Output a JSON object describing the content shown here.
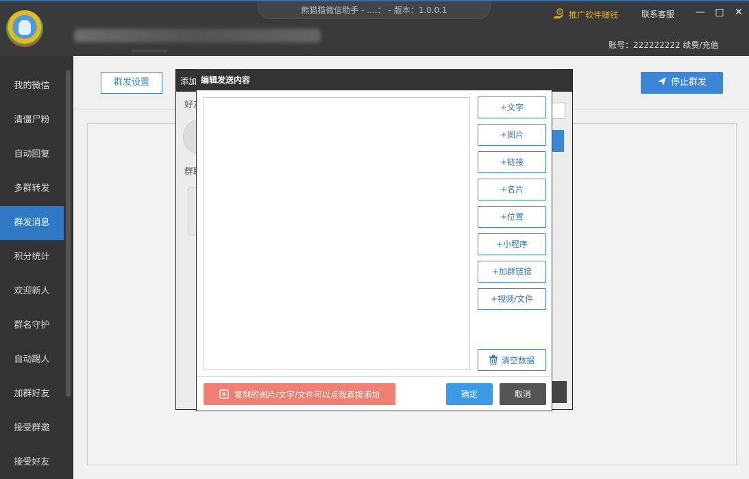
{
  "window": {
    "title": "熊猫猫微信助手 - ....：          - 版本：1.0.0.1",
    "promo_label": "推广软件赚钱",
    "contact_label": "联系客服",
    "minimize": "—",
    "maximize": "□",
    "close": "✕",
    "account": "账号：222222222 续费/充值"
  },
  "sidebar": {
    "items": [
      {
        "label": "我的微信"
      },
      {
        "label": "清僵尸粉"
      },
      {
        "label": "自动回复"
      },
      {
        "label": "多群转发"
      },
      {
        "label": "群发消息",
        "active": true
      },
      {
        "label": "积分统计"
      },
      {
        "label": "欢迎新人"
      },
      {
        "label": "群名守护"
      },
      {
        "label": "自动踢人"
      },
      {
        "label": "加群好友"
      },
      {
        "label": "接受群邀"
      },
      {
        "label": "接受好友"
      }
    ]
  },
  "main": {
    "group_settings": "群发设置",
    "stop_button": "停止群发"
  },
  "bg_dialog": {
    "title": "添加",
    "label_friends": "好友",
    "label_groups": "群聊"
  },
  "dialog": {
    "title": "编辑发送内容",
    "editor_value": "",
    "add_buttons": [
      {
        "label": "+文字"
      },
      {
        "label": "+图片"
      },
      {
        "label": "+链接"
      },
      {
        "label": "+名片"
      },
      {
        "label": "+位置"
      },
      {
        "label": "+小程序"
      },
      {
        "label": "+加群链接"
      },
      {
        "label": "+视频/文件"
      }
    ],
    "clear_label": "清空数据",
    "paste_label": "复制的图片/文字/文件可以点我直接添加",
    "ok_label": "确定",
    "cancel_label": "取消"
  },
  "colors": {
    "accent": "#3b86d6",
    "active_nav": "#2f78c4",
    "paste": "#f07f72",
    "promo": "#d8a628"
  },
  "icons": [
    "logo-icon",
    "hand-coin-icon",
    "send-plane-icon",
    "trash-icon",
    "add-file-icon"
  ]
}
